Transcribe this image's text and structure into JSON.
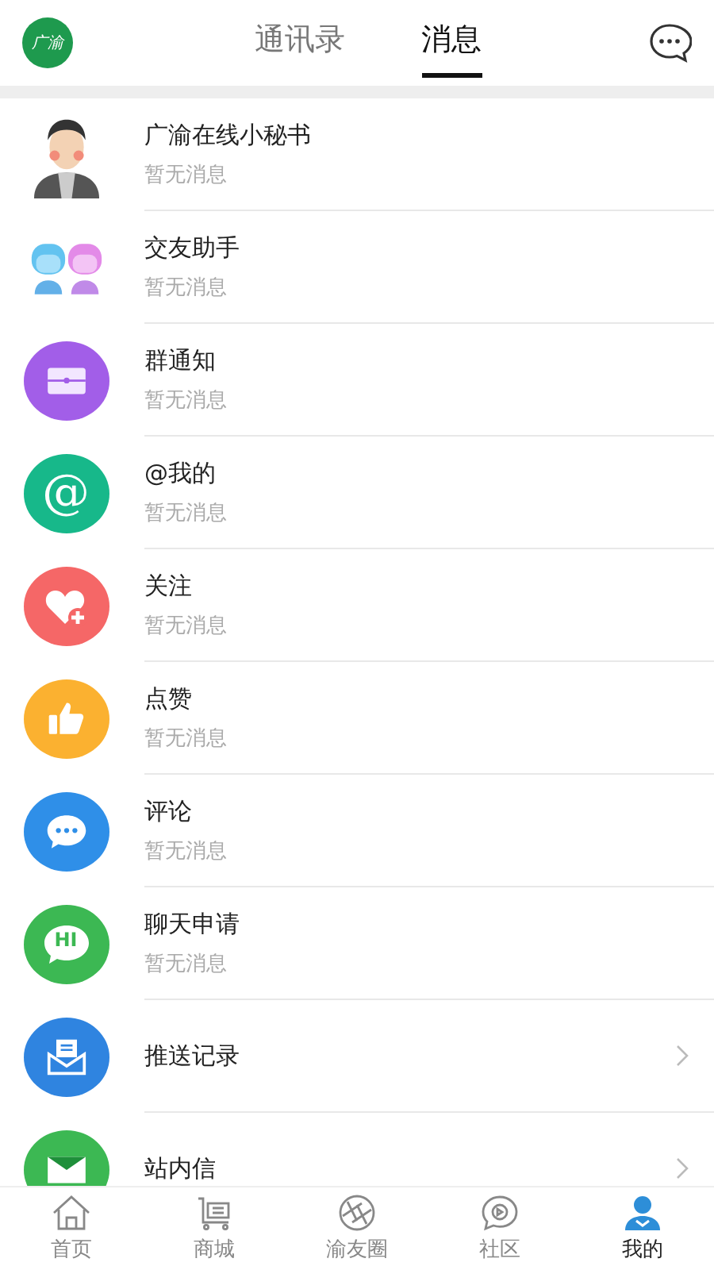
{
  "header": {
    "logo": "广渝",
    "tabs": [
      {
        "label": "通讯录",
        "selected": false
      },
      {
        "label": "消息",
        "selected": true
      }
    ]
  },
  "messages": [
    {
      "kind": "avatar",
      "title": "广渝在线小秘书",
      "preview": "暂无消息",
      "arrow": false
    },
    {
      "kind": "friends",
      "title": "交友助手",
      "preview": "暂无消息",
      "arrow": false
    },
    {
      "kind": "group",
      "title": "群通知",
      "preview": "暂无消息",
      "arrow": false
    },
    {
      "kind": "at",
      "glyph": "@",
      "title": "@我的",
      "preview": "暂无消息",
      "arrow": false
    },
    {
      "kind": "follow",
      "title": "关注",
      "preview": "暂无消息",
      "arrow": false
    },
    {
      "kind": "like",
      "title": "点赞",
      "preview": "暂无消息",
      "arrow": false
    },
    {
      "kind": "comment",
      "title": "评论",
      "preview": "暂无消息",
      "arrow": false
    },
    {
      "kind": "hi",
      "glyph": "HI",
      "title": "聊天申请",
      "preview": "暂无消息",
      "arrow": false
    },
    {
      "kind": "push",
      "title": "推送记录",
      "arrow": true
    },
    {
      "kind": "mail",
      "title": "站内信",
      "arrow": true
    }
  ],
  "tabbar": [
    {
      "kind": "home",
      "label": "首页",
      "selected": false
    },
    {
      "kind": "cart",
      "label": "商城",
      "selected": false
    },
    {
      "kind": "aperture",
      "label": "渝友圈",
      "selected": false
    },
    {
      "kind": "chat",
      "label": "社区",
      "selected": false
    },
    {
      "kind": "user",
      "label": "我的",
      "selected": true
    }
  ]
}
